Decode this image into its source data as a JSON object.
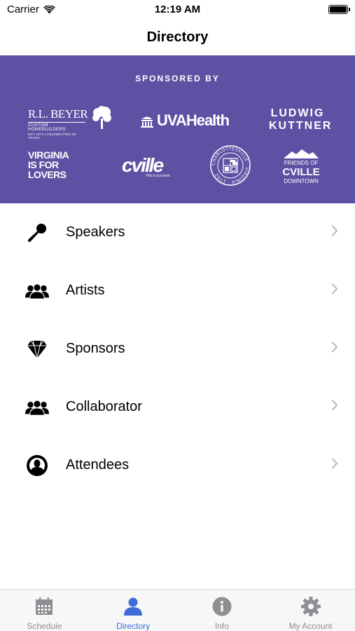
{
  "status_bar": {
    "carrier": "Carrier",
    "time": "12:19 AM"
  },
  "nav": {
    "title": "Directory"
  },
  "sponsors": {
    "heading": "SPONSORED BY",
    "background_color": "#5e51a3",
    "rlbeyer": {
      "name": "R.L. BEYER",
      "line1": "CUSTOM HOMEBUILDERS",
      "line2": "EST 1973 | CELEBRATING 50 YEARS"
    },
    "uva": {
      "text": "UVAHealth"
    },
    "ludwig": {
      "line1": "LUDWIG",
      "line2": "KUTTNER"
    },
    "virginia": {
      "line1": "VIRGINIA",
      "line2": "IS FOR",
      "line3": "LOVERS"
    },
    "cville": {
      "text": "cville",
      "tagline": "This is our town."
    },
    "seal": {
      "text": "CHARLOTTESVILLE · VIRGINIA · 1762"
    },
    "friends": {
      "line1": "FRIENDS OF",
      "line2": "CVILLE",
      "line3": "DOWNTOWN"
    }
  },
  "directory": {
    "items": [
      {
        "label": "Speakers",
        "icon": "microphone-icon"
      },
      {
        "label": "Artists",
        "icon": "group-icon"
      },
      {
        "label": "Sponsors",
        "icon": "diamond-icon"
      },
      {
        "label": "Collaborator",
        "icon": "group-icon"
      },
      {
        "label": "Attendees",
        "icon": "person-circle-icon"
      }
    ]
  },
  "tab_bar": {
    "active_color": "#3f6bd6",
    "inactive_color": "#8e8e93",
    "tabs": [
      {
        "label": "Schedule",
        "icon": "calendar-icon",
        "active": false
      },
      {
        "label": "Directory",
        "icon": "person-icon",
        "active": true
      },
      {
        "label": "Info",
        "icon": "info-icon",
        "active": false
      },
      {
        "label": "My Account",
        "icon": "gear-icon",
        "active": false
      }
    ]
  }
}
